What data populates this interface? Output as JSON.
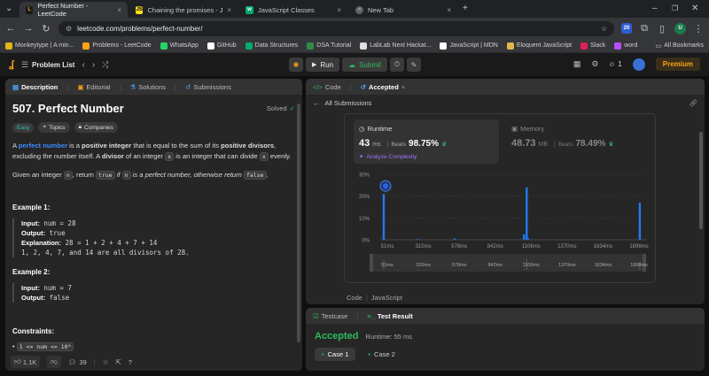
{
  "browser": {
    "tabs": [
      {
        "title": "Perfect Number - LeetCode",
        "icon": "leetcode-icon",
        "color": "#ffa116"
      },
      {
        "title": "Chaining the promises - JavaSc",
        "icon": "javascript-icon",
        "color": "#f7df1e"
      },
      {
        "title": "JavaScript Classes",
        "icon": "w3schools-icon",
        "color": "#04aa6d"
      },
      {
        "title": "New Tab",
        "icon": "chrome-icon",
        "color": "#9aa0a6"
      }
    ],
    "url": "leetcode.com/problems/perfect-number/",
    "bookmarks": [
      {
        "label": "Monkeytype | A min...",
        "color": "#e2b714"
      },
      {
        "label": "Problems - LeetCode",
        "color": "#ffa116"
      },
      {
        "label": "WhatsApp",
        "color": "#25d366"
      },
      {
        "label": "GitHub",
        "color": "#ffffff"
      },
      {
        "label": "Data Structures",
        "color": "#04aa6d"
      },
      {
        "label": "DSA Tutorial",
        "color": "#2f8d46"
      },
      {
        "label": "LabLab Next Hackat...",
        "color": "#dddddd"
      },
      {
        "label": "JavaScript | MDN",
        "color": "#ffffff"
      },
      {
        "label": "Eloquent JavaScript",
        "color": "#e0b84a"
      },
      {
        "label": "Slack",
        "color": "#e01e5a"
      },
      {
        "label": "word",
        "color": "#b84dff"
      }
    ],
    "all_bookmarks": "All Bookmarks",
    "profile_letter": "U",
    "ext_badge": "20"
  },
  "lcnav": {
    "problem_list": "Problem List",
    "run": "Run",
    "submit": "Submit",
    "fire_count": "1",
    "premium": "Premium"
  },
  "left": {
    "tabs": [
      "Description",
      "Editorial",
      "Solutions",
      "Submissions"
    ],
    "title": "507. Perfect Number",
    "status": "Solved",
    "tags": [
      "Easy",
      "Topics",
      "Companies"
    ],
    "desc1": {
      "a": "A ",
      "b": "perfect number",
      "c": " is a ",
      "d": "positive integer",
      "e": " that is equal to the sum of its ",
      "f": "positive divisors",
      "g": ", excluding the number itself. A ",
      "h": "divisor",
      "i": " of an integer ",
      "j": "x",
      "k": " is an integer that can divide ",
      "l": "x",
      "m": " evenly."
    },
    "desc2": {
      "a": "Given an integer ",
      "b": "n",
      "c": ", return ",
      "d": "true",
      "e": " if ",
      "f": "n",
      "g": " is a perfect number, otherwise return ",
      "h": "false",
      "i": "."
    },
    "ex1_title": "Example 1:",
    "ex1": {
      "input_label": "Input:",
      "input": " num = 28",
      "output_label": "Output:",
      "output": " true",
      "expl_label": "Explanation:",
      "expl": " 28 = 1 + 2 + 4 + 7 + 14",
      "expl2": "1, 2, 4, 7, and 14 are all divisors of 28."
    },
    "ex2_title": "Example 2:",
    "ex2": {
      "input_label": "Input:",
      "input": " num = 7",
      "output_label": "Output:",
      "output": " false"
    },
    "constraints_title": "Constraints:",
    "constraint": "1 <= num <= 10⁸",
    "likes": "1.1K",
    "comments": "39"
  },
  "right": {
    "tabs": [
      "Code",
      "Accepted"
    ],
    "all_submissions": "All Submissions",
    "runtime_label": "Runtime",
    "runtime_value": "43",
    "runtime_unit": "ms",
    "beats_label": "Beats",
    "runtime_beats": "98.75%",
    "analyze": "Analyze Complexity",
    "memory_label": "Memory",
    "memory_value": "48.73",
    "memory_unit": "MB",
    "memory_beats": "78.49%",
    "code_label": "Code",
    "lang_label": "JavaScript",
    "testcase_tab": "Testcase",
    "testresult_tab": "Test Result",
    "accepted": "Accepted",
    "runtime_result": "Runtime: 55 ms",
    "cases": [
      "Case 1",
      "Case 2"
    ]
  },
  "chart_data": {
    "type": "bar",
    "ylabels": [
      "30%",
      "20%",
      "10%",
      "0%"
    ],
    "ylim": [
      0,
      30
    ],
    "xlabels": [
      "51ms",
      "315ms",
      "578ms",
      "842ms",
      "1106ms",
      "1370ms",
      "1634ms",
      "1898ms"
    ],
    "brush_labels": [
      "51ms",
      "315ms",
      "578ms",
      "842ms",
      "1106ms",
      "1370ms",
      "1634ms",
      "1898ms"
    ],
    "x": [
      51,
      300,
      570,
      1080,
      1100,
      1110,
      1930
    ],
    "values": [
      21,
      0.3,
      0.6,
      2.5,
      24,
      0.7,
      17
    ],
    "xlim": [
      51,
      1950
    ],
    "bar_color": "#1e7bf0",
    "user_marker_x": 51
  }
}
